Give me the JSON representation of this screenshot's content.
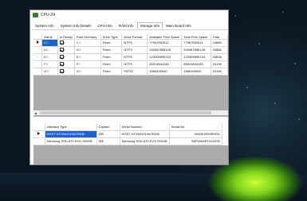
{
  "window": {
    "title": "CPU-Z4"
  },
  "tabs": [
    {
      "label": "System Info"
    },
    {
      "label": "System Info Details"
    },
    {
      "label": "CPU Info"
    },
    {
      "label": "RAM Info"
    },
    {
      "label": "Storage Info",
      "active": true
    },
    {
      "label": "Main Board Info"
    }
  ],
  "drives_table": {
    "headers": [
      "Name",
      "Is Ready",
      "Root Directory",
      "Drive Type",
      "Drive Format",
      "Available Free Space",
      "Total Free Space",
      "Total"
    ],
    "rows": [
      {
        "name": "C:\\",
        "root": "C:\\",
        "type": "Fixed",
        "format": "NTFS",
        "avail": "77967552512",
        "total_free": "77967552512",
        "total": "24884"
      },
      {
        "name": "D:\\",
        "root": "D:\\",
        "type": "Fixed",
        "format": "NTFS",
        "avail": "240967856128",
        "total_free": "240967856128",
        "total": "24884"
      },
      {
        "name": "E:\\",
        "root": "E:\\",
        "type": "Fixed",
        "format": "NTFS",
        "avail": "123309895744",
        "total_free": "123309895744",
        "total": "53608"
      },
      {
        "name": "F:\\",
        "root": "F:\\",
        "type": "Fixed",
        "format": "NTFS",
        "avail": "65514844160",
        "total_free": "65514844160",
        "total": "16106"
      },
      {
        "name": "G:\\",
        "root": "G:\\",
        "type": "Fixed",
        "format": "FAT32",
        "avail": "1866199040",
        "total_free": "1866199040",
        "total": "16106"
      }
    ]
  },
  "disks_table": {
    "headers": [
      "Interface Type",
      "Caption",
      "Serial Number",
      "Serial No"
    ],
    "rows": [
      {
        "iface": "HGST HTS541010A7E630",
        "caption": "IDE",
        "serial": "HGST HTS541010A7E630",
        "serial_no": "50830155HRVRX"
      },
      {
        "iface": "Samsung SSD 870 EVO 250GB",
        "caption": "IDE",
        "serial": "Samsung SSD 870 EVO 250GB",
        "serial_no": "S6PUNMRT01287B"
      }
    ]
  }
}
